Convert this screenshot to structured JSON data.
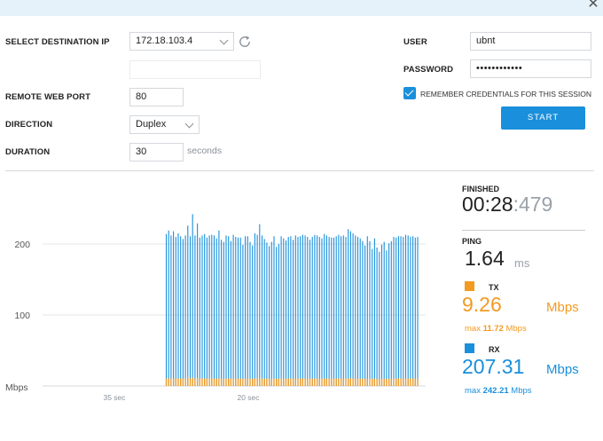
{
  "window": {
    "close_glyph": "✕"
  },
  "form": {
    "destination_label": "SELECT DESTINATION IP",
    "destination_value": "172.18.103.4",
    "extra_value": "",
    "port_label": "REMOTE WEB PORT",
    "port_value": "80",
    "direction_label": "DIRECTION",
    "direction_value": "Duplex",
    "duration_label": "DURATION",
    "duration_value": "30",
    "duration_unit": "seconds",
    "user_label": "USER",
    "user_value": "ubnt",
    "password_label": "PASSWORD",
    "password_value": "••••••••••••",
    "remember_label": "REMEMBER CREDENTIALS FOR THIS SESSION",
    "remember_checked": true,
    "start_label": "START"
  },
  "results": {
    "finished_label": "FINISHED",
    "timer_main": "00:28",
    "timer_ms": ":479",
    "ping_label": "PING",
    "ping_value": "1.64",
    "ping_unit": "ms",
    "tx_label": "TX",
    "tx_value": "9.26",
    "tx_unit": "Mbps",
    "tx_max_prefix": "max",
    "tx_max_value": "11.72",
    "tx_max_unit": "Mbps",
    "rx_label": "RX",
    "rx_value": "207.31",
    "rx_unit": "Mbps",
    "rx_max_prefix": "max",
    "rx_max_value": "242.21",
    "rx_max_unit": "Mbps",
    "colors": {
      "tx": "#f39a21",
      "rx": "#1a8fdb",
      "accent": "#1a8fdb"
    }
  },
  "chart_data": {
    "type": "bar",
    "ylabel": "Mbps",
    "ylim": [
      0,
      245
    ],
    "y_ticks": [
      100,
      200
    ],
    "x_ticks": [
      "35 sec",
      "20 sec"
    ],
    "x_tick_seconds_ago": [
      35,
      20
    ],
    "grid": true,
    "series": [
      {
        "name": "RX",
        "color": "#1a8fdb",
        "values": [
          214,
          219,
          212,
          218,
          210,
          215,
          211,
          207,
          212,
          226,
          211,
          242,
          212,
          229,
          209,
          212,
          214,
          209,
          212,
          213,
          212,
          208,
          219,
          206,
          203,
          212,
          211,
          204,
          213,
          210,
          209,
          209,
          199,
          211,
          211,
          203,
          198,
          215,
          213,
          228,
          212,
          207,
          202,
          197,
          203,
          211,
          196,
          200,
          211,
          208,
          205,
          210,
          211,
          206,
          212,
          210,
          211,
          213,
          212,
          210,
          206,
          210,
          213,
          212,
          210,
          208,
          214,
          212,
          210,
          209,
          209,
          211,
          213,
          211,
          212,
          210,
          221,
          218,
          215,
          212,
          210,
          208,
          204,
          198,
          211,
          204,
          193,
          208,
          195,
          189,
          199,
          203,
          191,
          201,
          204,
          210,
          209,
          211,
          211,
          210,
          213,
          212,
          210,
          211,
          209,
          210
        ]
      },
      {
        "name": "TX",
        "color": "#f39a21",
        "values": [
          9.3,
          9.5,
          9.1,
          9.4,
          9.2,
          9.6,
          9.3,
          9.0,
          9.4,
          11.7,
          9.2,
          10.8,
          9.3,
          9.9,
          9.1,
          9.4,
          9.5,
          9.2,
          9.3,
          9.4,
          9.2,
          9.1,
          9.6,
          9.0,
          9.0,
          9.3,
          9.2,
          9.1,
          9.4,
          9.2,
          9.2,
          9.2,
          8.9,
          9.3,
          9.3,
          9.0,
          8.8,
          9.5,
          9.4,
          10.2,
          9.3,
          9.1,
          9.0,
          8.8,
          9.0,
          9.3,
          8.7,
          8.9,
          9.3,
          9.2,
          9.1,
          9.2,
          9.3,
          9.1,
          9.3,
          9.2,
          9.3,
          9.4,
          9.3,
          9.2,
          9.1,
          9.2,
          9.4,
          9.3,
          9.2,
          9.2,
          9.4,
          9.3,
          9.2,
          9.2,
          9.2,
          9.3,
          9.4,
          9.3,
          9.3,
          9.2,
          9.7,
          9.6,
          9.5,
          9.3,
          9.2,
          9.2,
          9.1,
          8.8,
          9.3,
          9.1,
          8.6,
          9.2,
          8.7,
          8.4,
          8.8,
          9.0,
          8.5,
          8.9,
          9.1,
          9.2,
          9.2,
          9.3,
          9.3,
          9.2,
          9.4,
          9.3,
          9.2,
          9.3,
          9.2,
          9.2
        ]
      }
    ]
  }
}
